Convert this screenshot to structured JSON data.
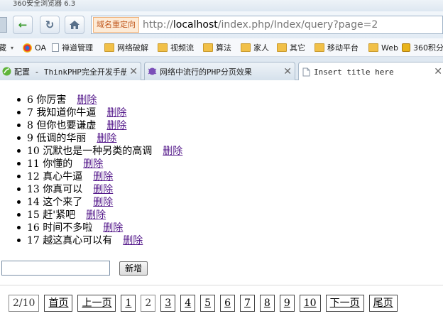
{
  "browser": {
    "title": "360安全浏览器 6.3",
    "address": {
      "redirect_badge": "域名重定向",
      "url_scheme": "http://",
      "url_host": "localhost",
      "url_path": "/index.php/Index/query?page=2"
    },
    "bookmarks": [
      {
        "label": "藏",
        "icon": "dropdown"
      },
      {
        "label": "OA",
        "icon": "chrome"
      },
      {
        "label": "禅道管理",
        "icon": "page"
      },
      {
        "label": "网络破解",
        "icon": "folder"
      },
      {
        "label": "视频流",
        "icon": "folder"
      },
      {
        "label": "算法",
        "icon": "folder"
      },
      {
        "label": "家人",
        "icon": "folder"
      },
      {
        "label": "其它",
        "icon": "folder"
      },
      {
        "label": "移动平台",
        "icon": "folder"
      },
      {
        "label": "Web",
        "icon": "folder"
      },
      {
        "label": "360积分",
        "icon": "gold"
      }
    ],
    "tabs": [
      {
        "label": "配置 - ThinkPHP完全开发手册",
        "icon": "leaf-icon"
      },
      {
        "label": "网络中流行的PHP分页效果",
        "icon": "bug-icon"
      },
      {
        "label": "Insert title here",
        "icon": "page-icon"
      }
    ]
  },
  "page": {
    "items": [
      {
        "id": "6",
        "text": "你厉害",
        "delete": "删除"
      },
      {
        "id": "7",
        "text": "我知道你牛逼",
        "delete": "删除"
      },
      {
        "id": "8",
        "text": "但你也要谦虚",
        "delete": "删除"
      },
      {
        "id": "9",
        "text": "低调的华丽",
        "delete": "删除"
      },
      {
        "id": "10",
        "text": "沉默也是一种另类的高调",
        "delete": "删除"
      },
      {
        "id": "11",
        "text": "你懂的",
        "delete": "删除"
      },
      {
        "id": "12",
        "text": "真心牛逼",
        "delete": "删除"
      },
      {
        "id": "13",
        "text": "你真可以",
        "delete": "删除"
      },
      {
        "id": "14",
        "text": "这个来了",
        "delete": "删除"
      },
      {
        "id": "15",
        "text": "赶'紧吧",
        "delete": "删除"
      },
      {
        "id": "16",
        "text": "时间不多啦",
        "delete": "删除"
      },
      {
        "id": "17",
        "text": "越这真心可以有",
        "delete": "删除"
      }
    ],
    "new_input_value": "",
    "new_button": "新增",
    "pager": {
      "status": "2/10",
      "first": "首页",
      "prev": "上一页",
      "pages": [
        "1",
        "2",
        "3",
        "4",
        "5",
        "6",
        "7",
        "8",
        "9",
        "10"
      ],
      "next": "下一页",
      "last": "尾页"
    }
  }
}
